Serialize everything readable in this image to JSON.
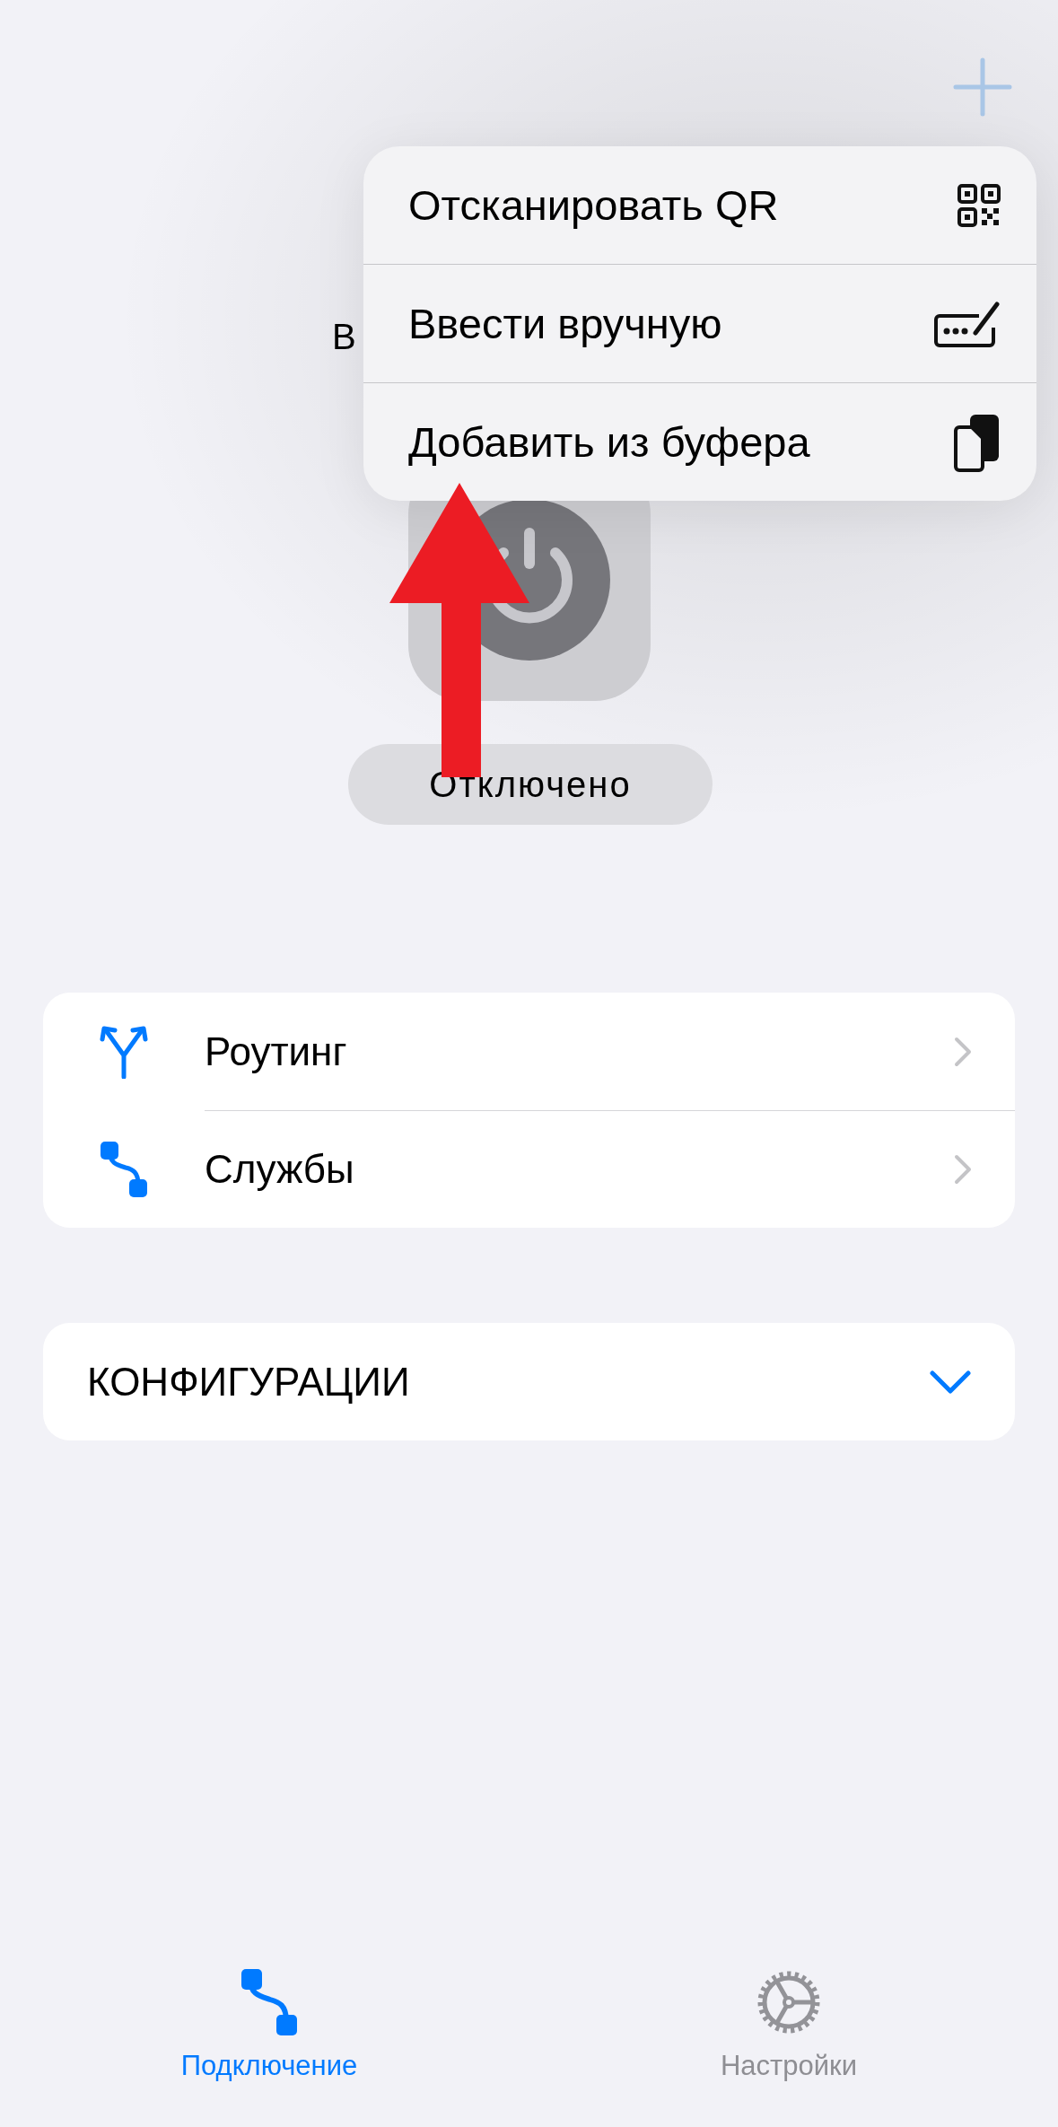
{
  "header": {
    "partial_title": "В"
  },
  "menu": {
    "items": [
      {
        "label": "Отсканировать QR",
        "kind": "qr"
      },
      {
        "label": "Ввести вручную",
        "kind": "keyboard"
      },
      {
        "label": "Добавить из буфера",
        "kind": "clipboard"
      }
    ]
  },
  "power": {
    "on": false
  },
  "status": "Отключено",
  "links": [
    {
      "label": "Роутинг",
      "kind": "routing"
    },
    {
      "label": "Службы",
      "kind": "services"
    }
  ],
  "configurations": {
    "title": "КОНФИГУРАЦИИ",
    "expanded": true
  },
  "tabs": [
    {
      "label": "Подключение",
      "kind": "connection",
      "selected": true
    },
    {
      "label": "Настройки",
      "kind": "settings",
      "selected": false
    }
  ]
}
